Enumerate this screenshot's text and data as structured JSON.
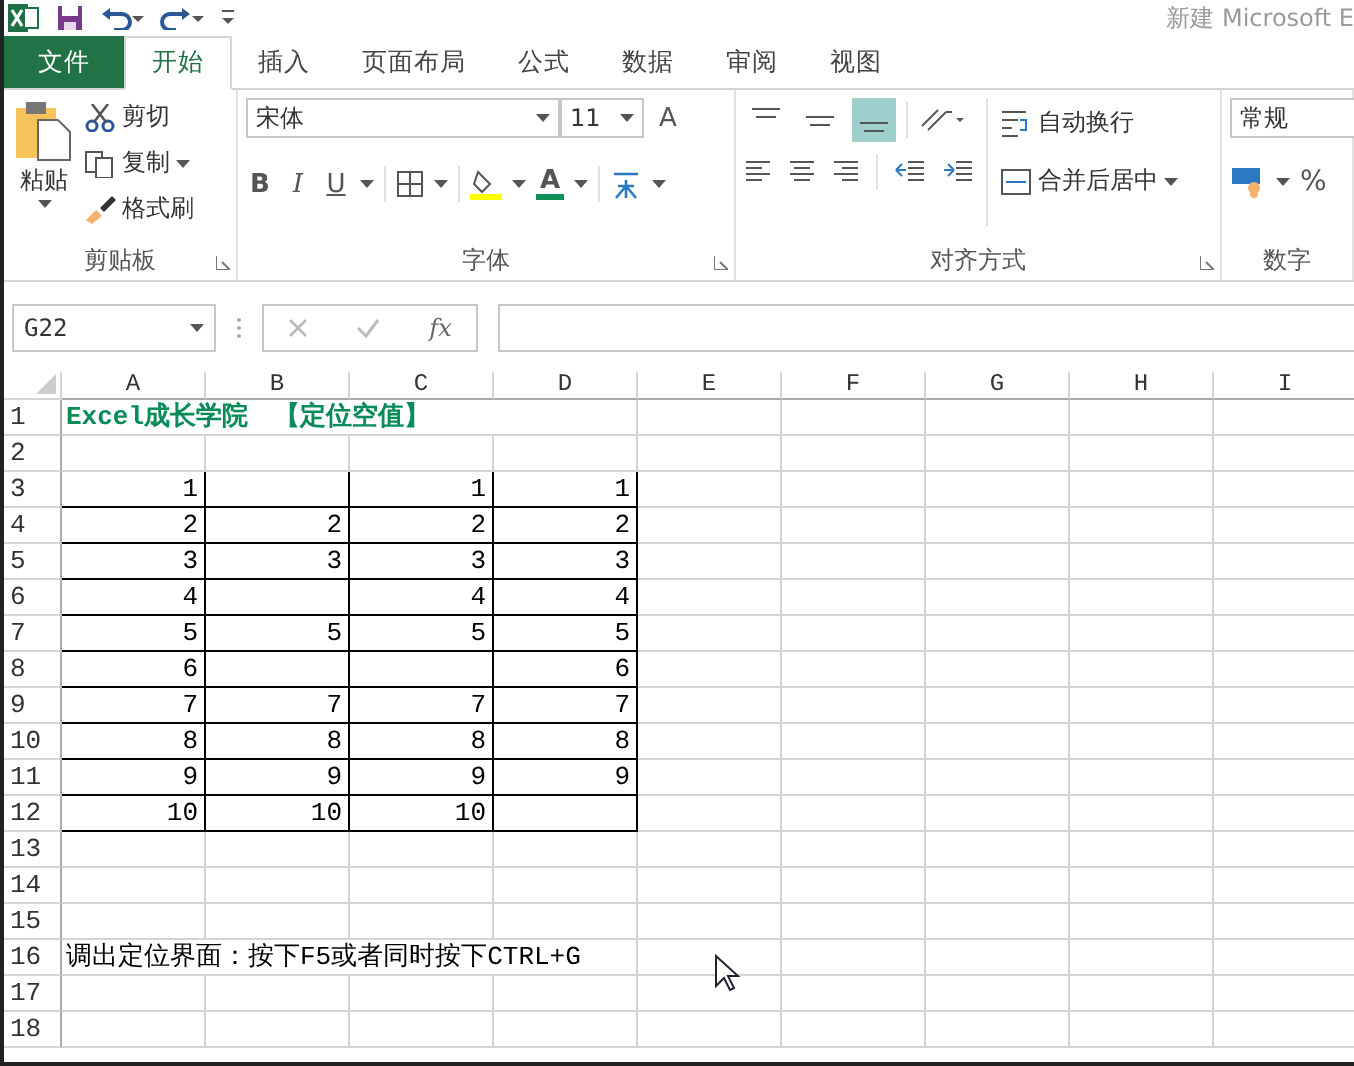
{
  "title_bar": {
    "title": "新建 Microsoft E"
  },
  "tabs": [
    {
      "label": "文件",
      "kind": "file",
      "selected": false
    },
    {
      "label": "开始",
      "kind": "tab",
      "selected": true
    },
    {
      "label": "插入",
      "kind": "tab",
      "selected": false
    },
    {
      "label": "页面布局",
      "kind": "tab",
      "selected": false
    },
    {
      "label": "公式",
      "kind": "tab",
      "selected": false
    },
    {
      "label": "数据",
      "kind": "tab",
      "selected": false
    },
    {
      "label": "审阅",
      "kind": "tab",
      "selected": false
    },
    {
      "label": "视图",
      "kind": "tab",
      "selected": false
    }
  ],
  "clipboard": {
    "paste": "粘贴",
    "cut": "剪切",
    "copy": "复制",
    "format_painter": "格式刷",
    "label": "剪贴板"
  },
  "font": {
    "font_name": "宋体",
    "font_size": "11",
    "bold": "B",
    "italic": "I",
    "underline": "U",
    "grow": "A",
    "font_color": "A",
    "label": "字体"
  },
  "alignment": {
    "vertical": [
      {
        "kind": "top",
        "selected": false
      },
      {
        "kind": "middle",
        "selected": false
      },
      {
        "kind": "bottom",
        "selected": true
      }
    ],
    "wrap_text": "自动换行",
    "merge_center": "合并后居中",
    "label": "对齐方式"
  },
  "number": {
    "format": "常规",
    "percent": "%",
    "label": "数字"
  },
  "formula_bar": {
    "name_box": "G22",
    "fx": "fx"
  },
  "columns": [
    "A",
    "B",
    "C",
    "D",
    "E",
    "F",
    "G",
    "H",
    "I"
  ],
  "rows": [
    {
      "number": "1",
      "kind": "title",
      "cells": [
        "Excel成长学院　【定位空值】"
      ]
    },
    {
      "number": "2",
      "kind": "empty"
    },
    {
      "number": "3",
      "kind": "data",
      "cells": [
        "1",
        null,
        "1",
        "1"
      ]
    },
    {
      "number": "4",
      "kind": "data",
      "cells": [
        "2",
        "2",
        "2",
        "2"
      ]
    },
    {
      "number": "5",
      "kind": "data",
      "cells": [
        "3",
        "3",
        "3",
        "3"
      ]
    },
    {
      "number": "6",
      "kind": "data",
      "cells": [
        "4",
        null,
        "4",
        "4"
      ]
    },
    {
      "number": "7",
      "kind": "data",
      "cells": [
        "5",
        "5",
        "5",
        "5"
      ]
    },
    {
      "number": "8",
      "kind": "data",
      "cells": [
        "6",
        null,
        null,
        "6"
      ]
    },
    {
      "number": "9",
      "kind": "data",
      "cells": [
        "7",
        "7",
        "7",
        "7"
      ]
    },
    {
      "number": "10",
      "kind": "data",
      "cells": [
        "8",
        "8",
        "8",
        "8"
      ]
    },
    {
      "number": "11",
      "kind": "data",
      "cells": [
        "9",
        "9",
        "9",
        "9"
      ]
    },
    {
      "number": "12",
      "kind": "data",
      "cells": [
        "10",
        "10",
        "10",
        null
      ]
    },
    {
      "number": "13",
      "kind": "empty"
    },
    {
      "number": "14",
      "kind": "empty"
    },
    {
      "number": "15",
      "kind": "empty"
    },
    {
      "number": "16",
      "kind": "note",
      "cells": [
        "调出定位界面：按下F5或者同时按下CTRL+G"
      ]
    },
    {
      "number": "17",
      "kind": "empty"
    },
    {
      "number": "18",
      "kind": "empty"
    }
  ]
}
